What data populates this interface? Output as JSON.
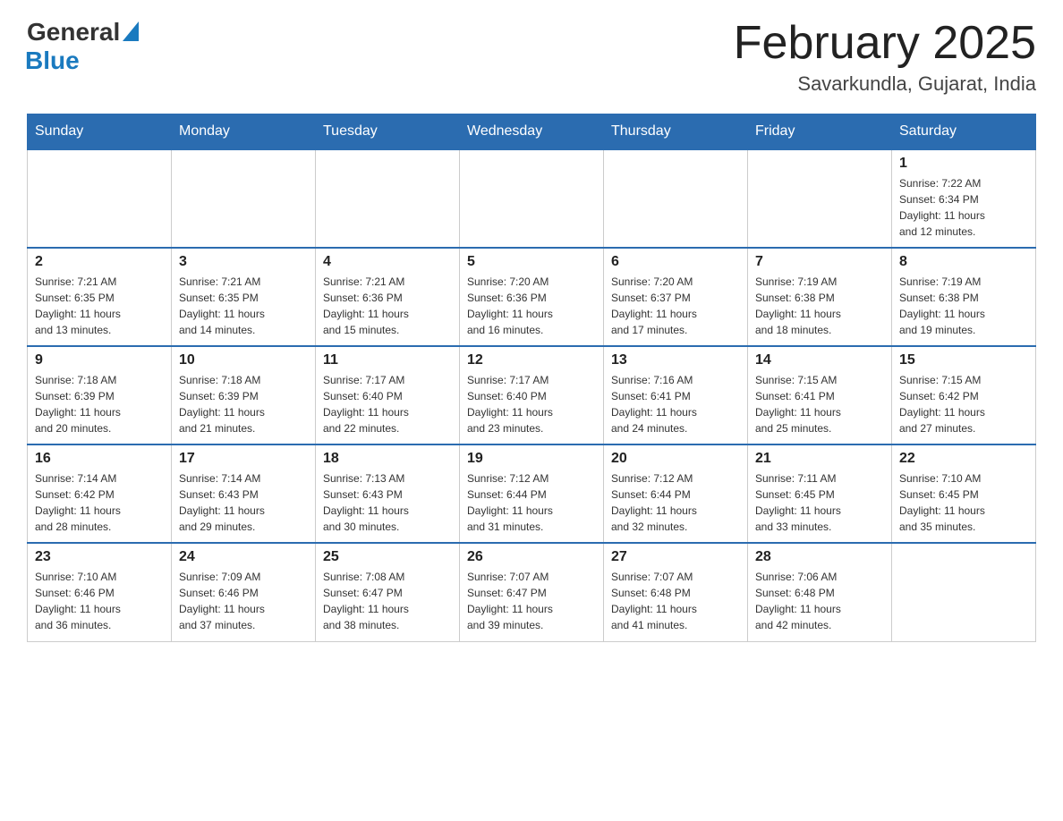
{
  "logo": {
    "general": "General",
    "blue": "Blue"
  },
  "title": "February 2025",
  "location": "Savarkundla, Gujarat, India",
  "days_of_week": [
    "Sunday",
    "Monday",
    "Tuesday",
    "Wednesday",
    "Thursday",
    "Friday",
    "Saturday"
  ],
  "weeks": [
    [
      {
        "day": "",
        "info": ""
      },
      {
        "day": "",
        "info": ""
      },
      {
        "day": "",
        "info": ""
      },
      {
        "day": "",
        "info": ""
      },
      {
        "day": "",
        "info": ""
      },
      {
        "day": "",
        "info": ""
      },
      {
        "day": "1",
        "info": "Sunrise: 7:22 AM\nSunset: 6:34 PM\nDaylight: 11 hours\nand 12 minutes."
      }
    ],
    [
      {
        "day": "2",
        "info": "Sunrise: 7:21 AM\nSunset: 6:35 PM\nDaylight: 11 hours\nand 13 minutes."
      },
      {
        "day": "3",
        "info": "Sunrise: 7:21 AM\nSunset: 6:35 PM\nDaylight: 11 hours\nand 14 minutes."
      },
      {
        "day": "4",
        "info": "Sunrise: 7:21 AM\nSunset: 6:36 PM\nDaylight: 11 hours\nand 15 minutes."
      },
      {
        "day": "5",
        "info": "Sunrise: 7:20 AM\nSunset: 6:36 PM\nDaylight: 11 hours\nand 16 minutes."
      },
      {
        "day": "6",
        "info": "Sunrise: 7:20 AM\nSunset: 6:37 PM\nDaylight: 11 hours\nand 17 minutes."
      },
      {
        "day": "7",
        "info": "Sunrise: 7:19 AM\nSunset: 6:38 PM\nDaylight: 11 hours\nand 18 minutes."
      },
      {
        "day": "8",
        "info": "Sunrise: 7:19 AM\nSunset: 6:38 PM\nDaylight: 11 hours\nand 19 minutes."
      }
    ],
    [
      {
        "day": "9",
        "info": "Sunrise: 7:18 AM\nSunset: 6:39 PM\nDaylight: 11 hours\nand 20 minutes."
      },
      {
        "day": "10",
        "info": "Sunrise: 7:18 AM\nSunset: 6:39 PM\nDaylight: 11 hours\nand 21 minutes."
      },
      {
        "day": "11",
        "info": "Sunrise: 7:17 AM\nSunset: 6:40 PM\nDaylight: 11 hours\nand 22 minutes."
      },
      {
        "day": "12",
        "info": "Sunrise: 7:17 AM\nSunset: 6:40 PM\nDaylight: 11 hours\nand 23 minutes."
      },
      {
        "day": "13",
        "info": "Sunrise: 7:16 AM\nSunset: 6:41 PM\nDaylight: 11 hours\nand 24 minutes."
      },
      {
        "day": "14",
        "info": "Sunrise: 7:15 AM\nSunset: 6:41 PM\nDaylight: 11 hours\nand 25 minutes."
      },
      {
        "day": "15",
        "info": "Sunrise: 7:15 AM\nSunset: 6:42 PM\nDaylight: 11 hours\nand 27 minutes."
      }
    ],
    [
      {
        "day": "16",
        "info": "Sunrise: 7:14 AM\nSunset: 6:42 PM\nDaylight: 11 hours\nand 28 minutes."
      },
      {
        "day": "17",
        "info": "Sunrise: 7:14 AM\nSunset: 6:43 PM\nDaylight: 11 hours\nand 29 minutes."
      },
      {
        "day": "18",
        "info": "Sunrise: 7:13 AM\nSunset: 6:43 PM\nDaylight: 11 hours\nand 30 minutes."
      },
      {
        "day": "19",
        "info": "Sunrise: 7:12 AM\nSunset: 6:44 PM\nDaylight: 11 hours\nand 31 minutes."
      },
      {
        "day": "20",
        "info": "Sunrise: 7:12 AM\nSunset: 6:44 PM\nDaylight: 11 hours\nand 32 minutes."
      },
      {
        "day": "21",
        "info": "Sunrise: 7:11 AM\nSunset: 6:45 PM\nDaylight: 11 hours\nand 33 minutes."
      },
      {
        "day": "22",
        "info": "Sunrise: 7:10 AM\nSunset: 6:45 PM\nDaylight: 11 hours\nand 35 minutes."
      }
    ],
    [
      {
        "day": "23",
        "info": "Sunrise: 7:10 AM\nSunset: 6:46 PM\nDaylight: 11 hours\nand 36 minutes."
      },
      {
        "day": "24",
        "info": "Sunrise: 7:09 AM\nSunset: 6:46 PM\nDaylight: 11 hours\nand 37 minutes."
      },
      {
        "day": "25",
        "info": "Sunrise: 7:08 AM\nSunset: 6:47 PM\nDaylight: 11 hours\nand 38 minutes."
      },
      {
        "day": "26",
        "info": "Sunrise: 7:07 AM\nSunset: 6:47 PM\nDaylight: 11 hours\nand 39 minutes."
      },
      {
        "day": "27",
        "info": "Sunrise: 7:07 AM\nSunset: 6:48 PM\nDaylight: 11 hours\nand 41 minutes."
      },
      {
        "day": "28",
        "info": "Sunrise: 7:06 AM\nSunset: 6:48 PM\nDaylight: 11 hours\nand 42 minutes."
      },
      {
        "day": "",
        "info": ""
      }
    ]
  ]
}
